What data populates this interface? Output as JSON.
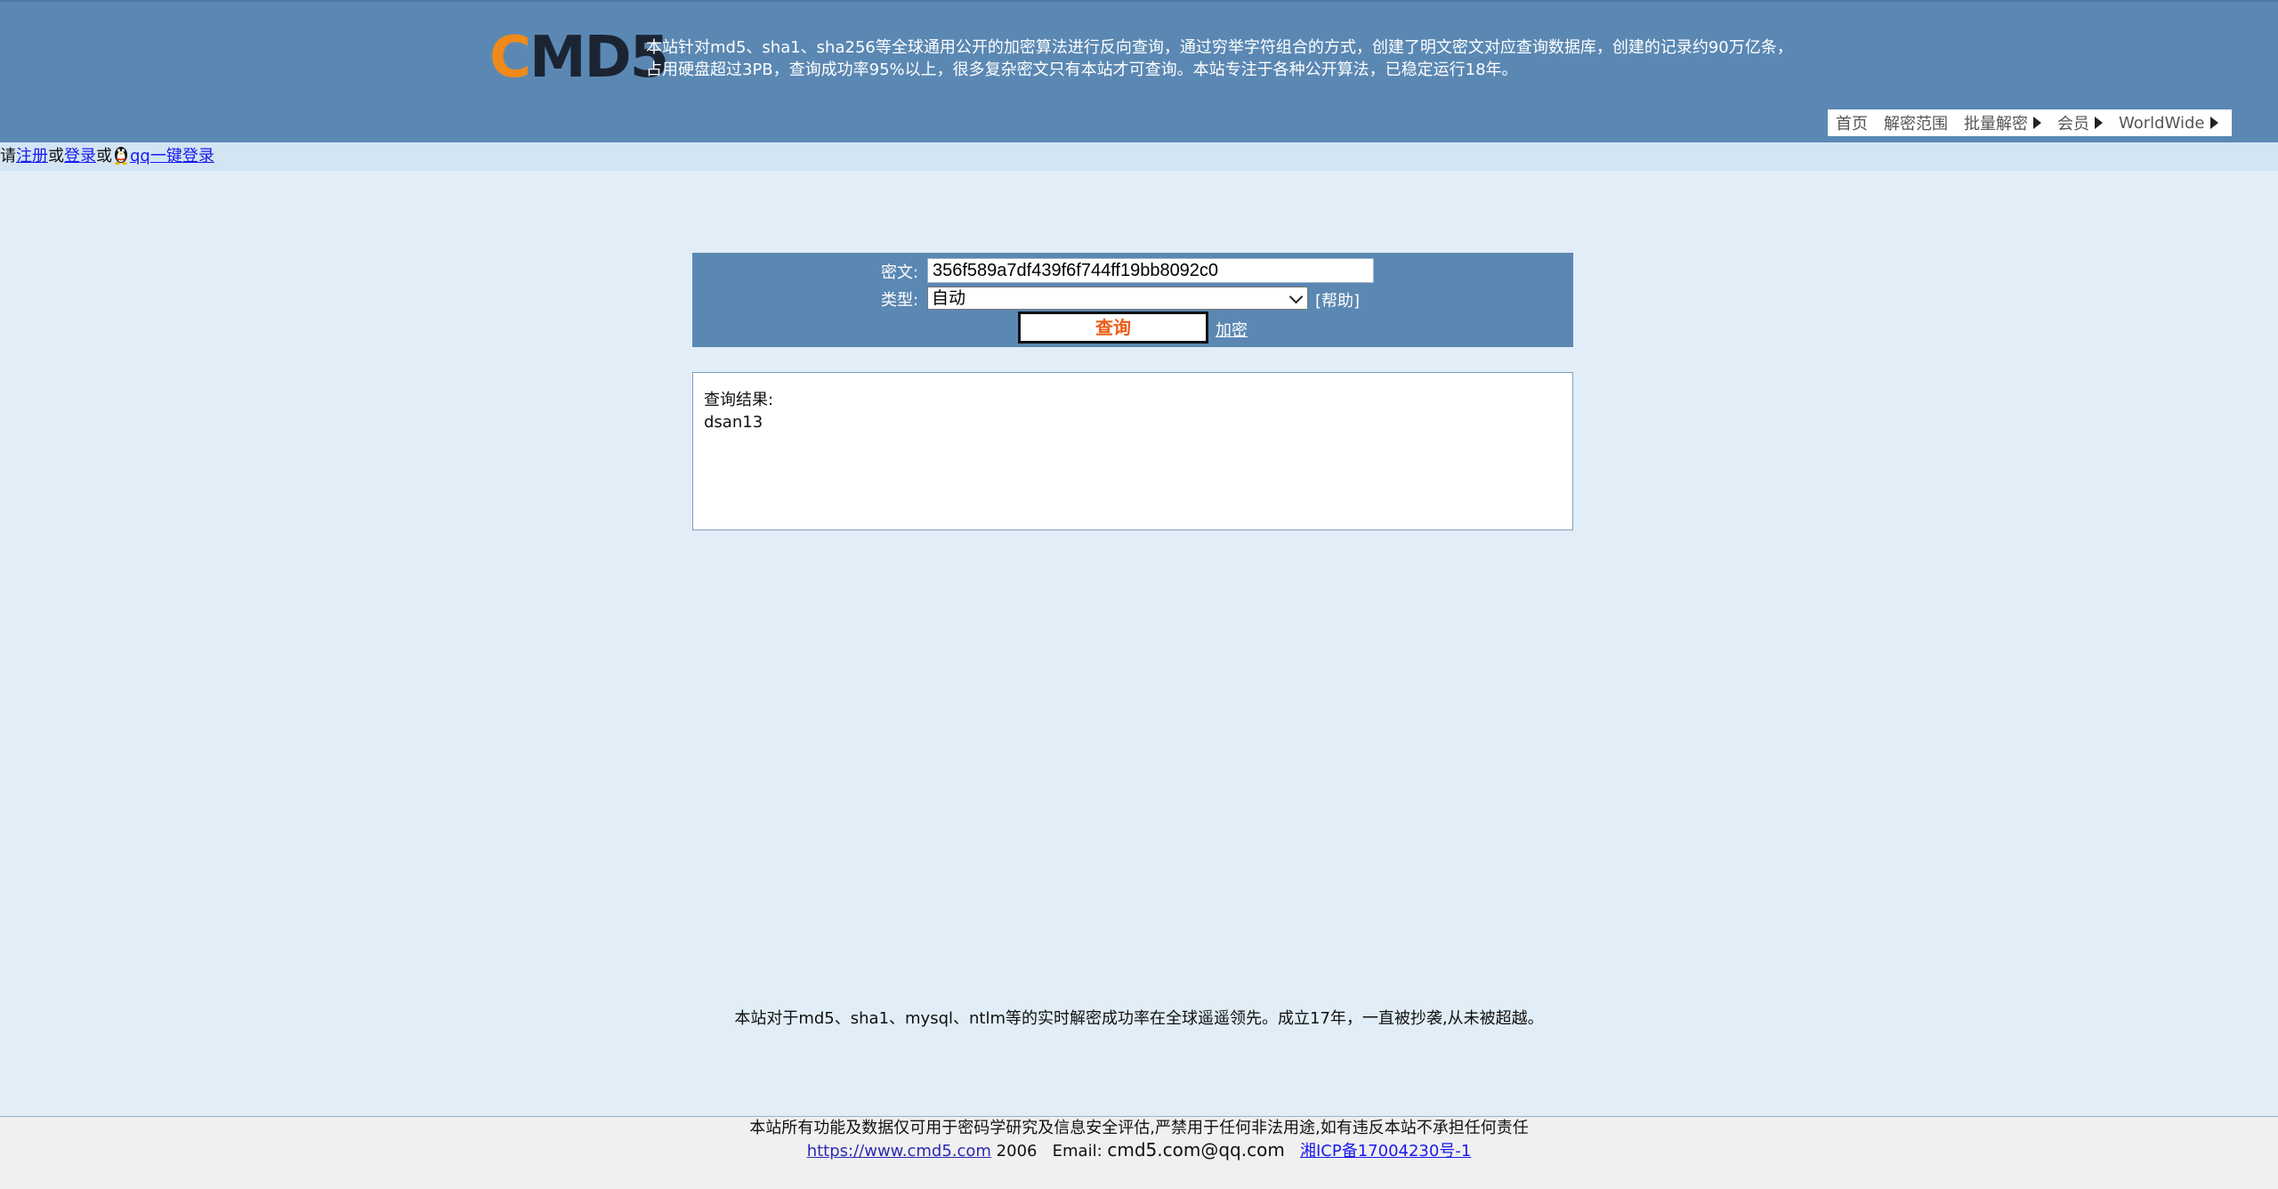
{
  "header": {
    "logo_c": "C",
    "logo_rest": "MD5",
    "intro_line1": "本站针对md5、sha1、sha256等全球通用公开的加密算法进行反向查询，通过穷举字符组合的方式，创建了明文密文对应查询数据库，创建的记录约90万亿条，",
    "intro_line2": "占用硬盘超过3PB，查询成功率95%以上，很多复杂密文只有本站才可查询。本站专注于各种公开算法，已稳定运行18年。",
    "nav": {
      "home": "首页",
      "scope": "解密范围",
      "batch": "批量解密",
      "member": "会员",
      "worldwide": "WorldWide"
    }
  },
  "loginbar": {
    "prefix": "请",
    "register": "注册",
    "or1": "或",
    "login": "登录",
    "or2": "或",
    "qq_login": "qq一键登录"
  },
  "query": {
    "cipher_label": "密文:",
    "cipher_value": "356f589a7df439f6f744ff19bb8092c0",
    "type_label": "类型:",
    "type_selected": "自动",
    "help": "[帮助]",
    "submit": "查询",
    "encrypt": "加密"
  },
  "result": {
    "label": "查询结果:",
    "value": "dsan13"
  },
  "tagline": "本站对于md5、sha1、mysql、ntlm等的实时解密成功率在全球遥遥领先。成立17年，一直被抄袭,从未被超越。",
  "footer": {
    "disclaimer": "本站所有功能及数据仅可用于密码学研究及信息安全评估,严禁用于任何非法用途,如有违反本站不承担任何责任",
    "site_link": "https://www.cmd5.com",
    "year": " 2006   Email: ",
    "email": "cmd5.com@qq.com",
    "icp": "湘ICP备17004230号-1"
  }
}
